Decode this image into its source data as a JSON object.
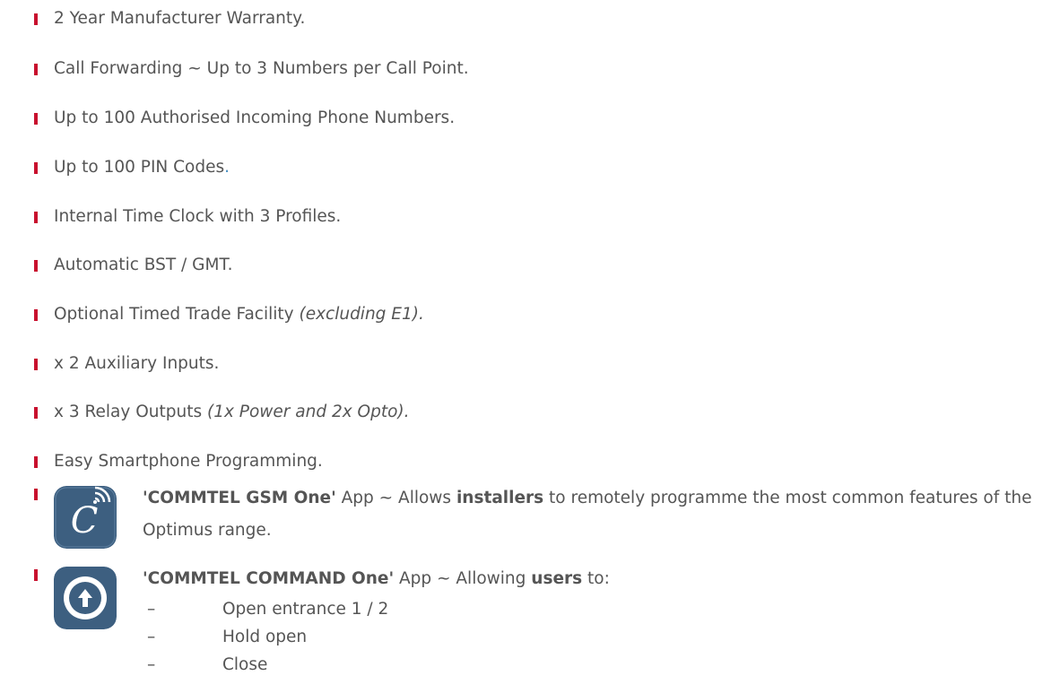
{
  "features": [
    {
      "text": "2 Year Manufacturer Warranty."
    },
    {
      "text": "Call Forwarding ~ Up to 3 Numbers per Call Point."
    },
    {
      "text": "Up to 100 Authorised Incoming Phone Numbers."
    },
    {
      "text": "Up to 100 PIN Codes",
      "tail": "."
    },
    {
      "text": "Internal Time Clock with 3 Profiles."
    },
    {
      "text": "Automatic BST / GMT."
    },
    {
      "text": "Optional Timed Trade Facility ",
      "italic": "(excluding E1)."
    },
    {
      "text": "x 2 Auxiliary Inputs."
    },
    {
      "text": "x 3 Relay Outputs ",
      "italic": "(1x Power and 2x Opto)."
    },
    {
      "text": "Easy Smartphone Programming."
    }
  ],
  "apps": {
    "gsm_one": {
      "name": "'COMMTEL GSM One'",
      "mid": " App ~ Allows ",
      "audience": "installers",
      "rest": " to remotely programme the most common features of the Optimus range.",
      "icon": "commtel-gsm-one-icon",
      "icon_color": "#3d5f80"
    },
    "command_one": {
      "name": "'COMMTEL COMMAND One'",
      "mid": " App ~ Allowing ",
      "audience": "users",
      "rest": " to:",
      "icon": "commtel-command-one-icon",
      "icon_color": "#3d5f80",
      "actions": [
        {
          "dash": "–",
          "label": "Open entrance 1 / 2"
        },
        {
          "dash": "–",
          "label": "Hold open"
        },
        {
          "dash": "–",
          "label": "Close"
        }
      ]
    }
  },
  "colors": {
    "bullet": "#c8102e",
    "text": "#555555",
    "app_icon_bg": "#3d5f80"
  }
}
